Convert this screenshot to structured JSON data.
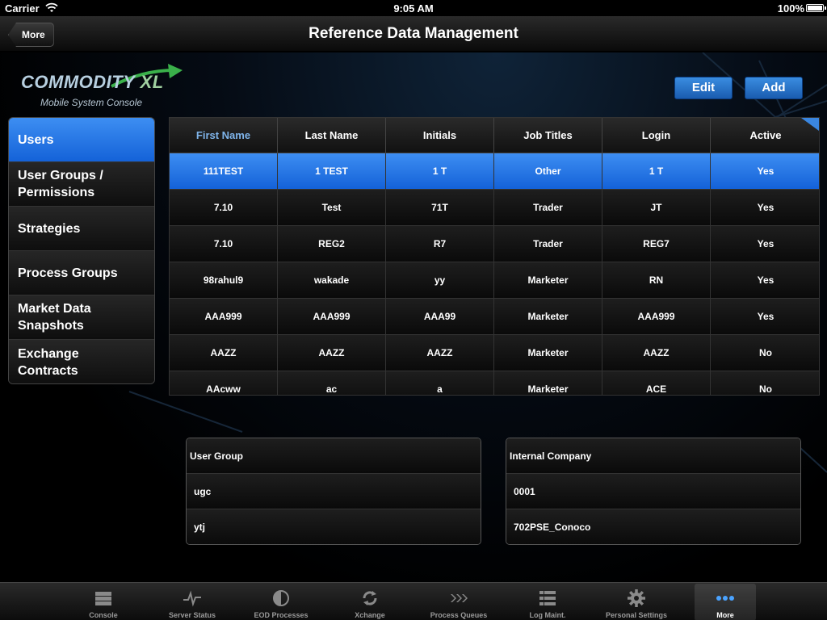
{
  "status_bar": {
    "carrier": "Carrier",
    "time": "9:05 AM",
    "battery": "100%"
  },
  "nav": {
    "back_label": "More",
    "title": "Reference Data Management"
  },
  "logo": {
    "word": "COMMODITY",
    "xl": "XL",
    "subtitle": "Mobile System Console"
  },
  "actions": {
    "edit_label": "Edit",
    "add_label": "Add"
  },
  "sidebar": {
    "items": [
      {
        "label": "Users",
        "selected": true
      },
      {
        "label": "User Groups / Permissions",
        "selected": false
      },
      {
        "label": "Strategies",
        "selected": false
      },
      {
        "label": "Process Groups",
        "selected": false
      },
      {
        "label": "Market Data Snapshots",
        "selected": false
      },
      {
        "label": "Exchange Contracts",
        "selected": false
      }
    ]
  },
  "users_table": {
    "columns": [
      "First Name",
      "Last Name",
      "Initials",
      "Job Titles",
      "Login",
      "Active"
    ],
    "sorted_column": 0,
    "rows": [
      [
        "111TEST",
        "1 TEST",
        "1 T",
        "Other",
        "1 T",
        "Yes"
      ],
      [
        "7.10",
        "Test",
        "71T",
        "Trader",
        "JT",
        "Yes"
      ],
      [
        "7.10",
        "REG2",
        "R7",
        "Trader",
        "REG7",
        "Yes"
      ],
      [
        "98rahul9",
        "wakade",
        "yy",
        "Marketer",
        "RN",
        "Yes"
      ],
      [
        "AAA999",
        "AAA999",
        "AAA99",
        "Marketer",
        "AAA999",
        "Yes"
      ],
      [
        "AAZZ",
        "AAZZ",
        "AAZZ",
        "Marketer",
        "AAZZ",
        "No"
      ],
      [
        "AAcww",
        "ac",
        "a",
        "Marketer",
        "ACE",
        "No"
      ]
    ],
    "selected_row": 0
  },
  "user_group_panel": {
    "header": "User Group",
    "items": [
      "ugc",
      "ytj"
    ]
  },
  "internal_company_panel": {
    "header": "Internal Company",
    "items": [
      "0001",
      "702PSE_Conoco"
    ]
  },
  "tab_bar": {
    "tabs": [
      {
        "label": "Console",
        "icon": "console-icon"
      },
      {
        "label": "Server Status",
        "icon": "pulse-icon"
      },
      {
        "label": "EOD Processes",
        "icon": "half-circle-icon"
      },
      {
        "label": "Xchange",
        "icon": "refresh-icon"
      },
      {
        "label": "Process Queues",
        "icon": "chevrons-icon"
      },
      {
        "label": "Log Maint.",
        "icon": "list-icon"
      },
      {
        "label": "Personal Settings",
        "icon": "gear-icon"
      },
      {
        "label": "More",
        "icon": "more-dots-icon"
      }
    ],
    "active": 7
  },
  "colors": {
    "accent_blue": "#1f74e8",
    "sorted_header": "#7fb4ea",
    "tab_inactive": "#9a9a9a"
  }
}
